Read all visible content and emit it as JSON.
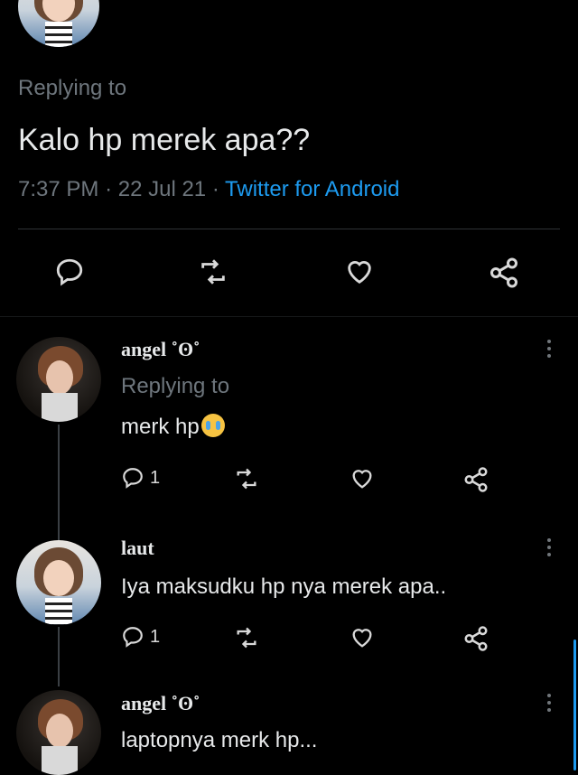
{
  "main_tweet": {
    "replying_to": "Replying to",
    "text": "Kalo hp merek apa??",
    "time": "7:37 PM",
    "date": "22 Jul 21",
    "sep": "·",
    "source": "Twitter for Android"
  },
  "replies": [
    {
      "name": "angel ˚ʘ˚",
      "replying_to": "Replying to",
      "text": "merk hp",
      "reply_count": "1"
    },
    {
      "name": "laut",
      "text": "Iya maksudku hp nya merek apa..",
      "reply_count": "1"
    },
    {
      "name": "angel ˚ʘ˚",
      "text": "laptopnya merk hp..."
    }
  ],
  "colors": {
    "accent": "#1d9bf0",
    "muted": "#6e767d",
    "background": "#000000"
  }
}
